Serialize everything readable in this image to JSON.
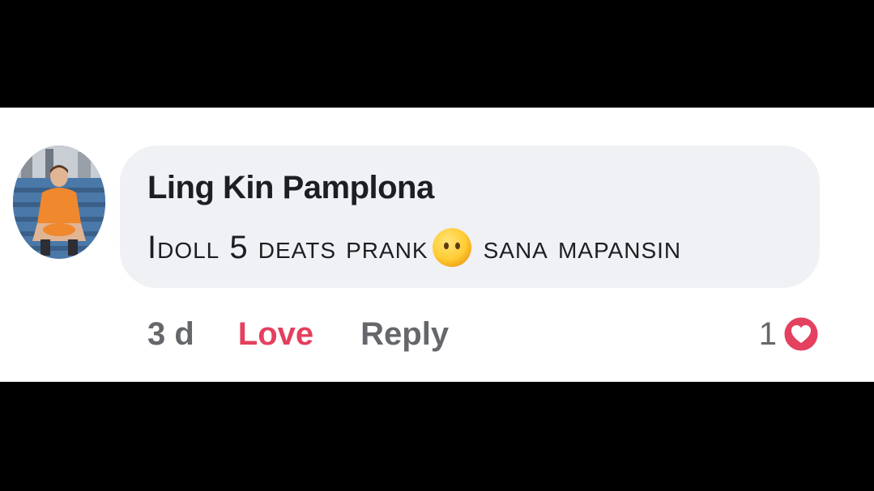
{
  "comment": {
    "author": "Ling Kin Pamplona",
    "text_part1": "Idoll 5 deats prank",
    "text_part2": "sana mapansin",
    "emoji": "face-without-mouth-emoji",
    "avatar": "profile-photo"
  },
  "actions": {
    "timestamp": "3 d",
    "love_label": "Love",
    "reply_label": "Reply"
  },
  "reactions": {
    "count": "1",
    "icon": "heart-icon",
    "heart_color": "#e4405f"
  },
  "colors": {
    "bubble": "#eff1f4",
    "text": "#1c1e21",
    "muted": "#65676b",
    "love": "#e4405f"
  }
}
